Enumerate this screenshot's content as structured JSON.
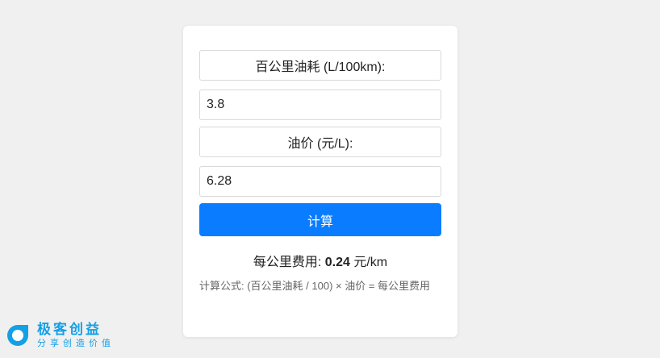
{
  "form": {
    "consumption_label": "百公里油耗 (L/100km):",
    "consumption_value": "3.8",
    "price_label": "油价 (元/L):",
    "price_value": "6.28",
    "calculate_label": "计算"
  },
  "result": {
    "prefix": "每公里费用: ",
    "value": "0.24",
    "unit": " 元/km"
  },
  "formula": "计算公式: (百公里油耗 / 100) × 油价 = 每公里费用",
  "logo": {
    "title": "极客创益",
    "subtitle": "分享创造价值",
    "icon": "geek-logo-icon",
    "color": "#14a0e6"
  },
  "colors": {
    "accent": "#0a7cff",
    "background": "#f0f0f0"
  }
}
